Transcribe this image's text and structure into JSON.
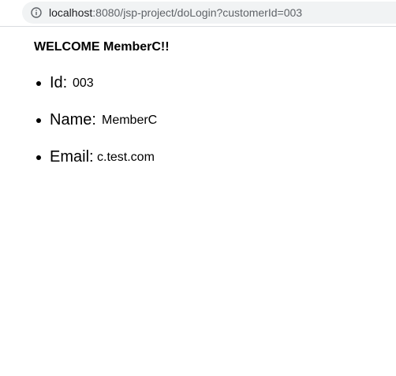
{
  "browser": {
    "url_host": "localhost",
    "url_path": ":8080/jsp-project/doLogin?customerId=003",
    "icon": "info-icon"
  },
  "page": {
    "welcome": "WELCOME MemberC!!",
    "fields": [
      {
        "label": "Id:",
        "value": "003"
      },
      {
        "label": "Name:",
        "value": "MemberC"
      },
      {
        "label": "Email:",
        "value": "c.test.com"
      }
    ]
  }
}
